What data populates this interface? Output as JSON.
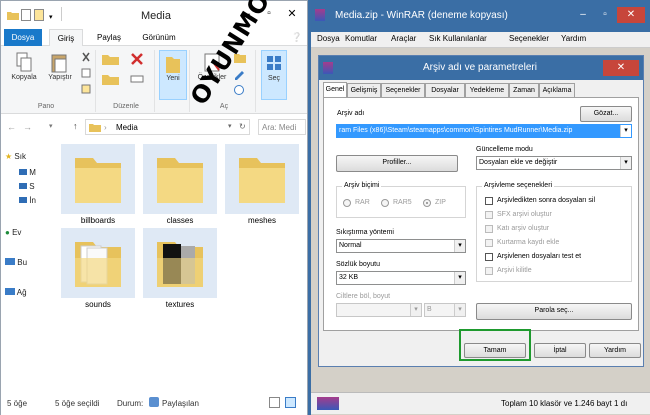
{
  "explorer": {
    "title": "Media",
    "tabs": [
      "Dosya",
      "Giriş",
      "Paylaş",
      "Görünüm"
    ],
    "ribbon": {
      "kopyala": "Kopyala",
      "yapistir": "Yapıştır",
      "pano": "Pano",
      "duzenle": "Düzenle",
      "yeni": "Yeni",
      "ozellikler": "Özellikler",
      "ac": "Aç",
      "sec": "Seç"
    },
    "address": "Media",
    "search_placeholder": "Ara: Medi",
    "nav_items": [
      "Sık",
      "M",
      "S",
      "İn",
      "Ev",
      "Bu",
      "Ağ"
    ],
    "folders": [
      "billboards",
      "classes",
      "meshes",
      "sounds",
      "textures"
    ],
    "status": {
      "count": "5 öğe",
      "selected": "5 öğe seçildi",
      "state_label": "Durum:",
      "state_value": "Paylaşılan"
    }
  },
  "winrar": {
    "title": "Media.zip - WinRAR (deneme kopyası)",
    "menu": [
      "Dosya",
      "Komutlar",
      "Araçlar",
      "Sık Kullanılanlar",
      "Seçenekler",
      "Yardım"
    ],
    "status_text": "Toplam 10 klasör ve 1.246 bayt 1 dı"
  },
  "dialog": {
    "title": "Arşiv adı ve parametreleri",
    "tabs": [
      "Genel",
      "Gelişmiş",
      "Seçenekler",
      "Dosyalar",
      "Yedekleme",
      "Zaman",
      "Açıklama"
    ],
    "archive_name_label": "Arşiv adı",
    "browse_button": "Gözat...",
    "archive_path": "ram Files (x86)\\Steam\\steamapps\\common\\Spintires MudRunner\\Media.zip",
    "profiles_button": "Profiller...",
    "update_mode_label": "Güncelleme modu",
    "update_mode_value": "Dosyaları ekle ve değiştir",
    "archive_format_label": "Arşiv biçimi",
    "formats": [
      "RAR",
      "RAR5",
      "ZIP"
    ],
    "archiving_options_label": "Arşivleme seçenekleri",
    "options": [
      "Arşivledikten sonra dosyaları sil",
      "SFX arşivi oluştur",
      "Katı arşiv oluştur",
      "Kurtarma kaydı ekle",
      "Arşivlenen dosyaları test et",
      "Arşivi kilitle"
    ],
    "compression_label": "Sıkıştırma yöntemi",
    "compression_value": "Normal",
    "dict_label": "Sözlük boyutu",
    "dict_value": "32 KB",
    "split_label": "Ciltlere böl, boyut",
    "split_unit": "B",
    "password_button": "Parola seç...",
    "ok_button": "Tamam",
    "cancel_button": "İptal",
    "help_button": "Yardım"
  },
  "watermark": "OYUNMODLARI.COM",
  "colors": {
    "accent": "#1979ca",
    "title_blue": "#3a6ea5",
    "highlight_green": "#1e9a2e",
    "selection": "#3399ff"
  }
}
